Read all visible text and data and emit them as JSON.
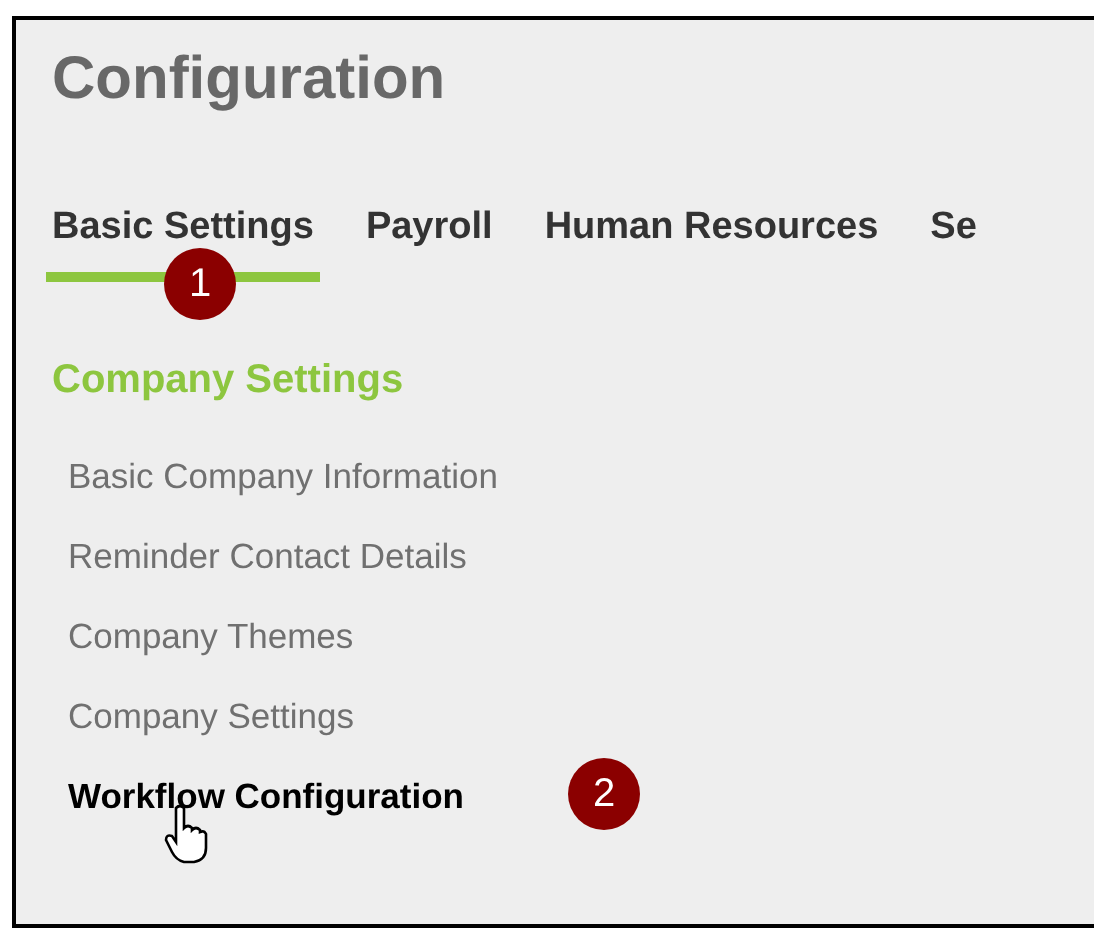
{
  "title": "Configuration",
  "tabs": [
    {
      "label": "Basic Settings",
      "selected": true,
      "callout": "1"
    },
    {
      "label": "Payroll",
      "selected": false
    },
    {
      "label": "Human Resources",
      "selected": false
    },
    {
      "label": "Se",
      "selected": false
    }
  ],
  "section": {
    "title": "Company Settings",
    "items": [
      {
        "label": "Basic Company Information",
        "selected": false
      },
      {
        "label": "Reminder Contact Details",
        "selected": false
      },
      {
        "label": "Company Themes",
        "selected": false
      },
      {
        "label": "Company Settings",
        "selected": false
      },
      {
        "label": "Workflow Configuration",
        "selected": true,
        "callout": "2"
      }
    ]
  }
}
